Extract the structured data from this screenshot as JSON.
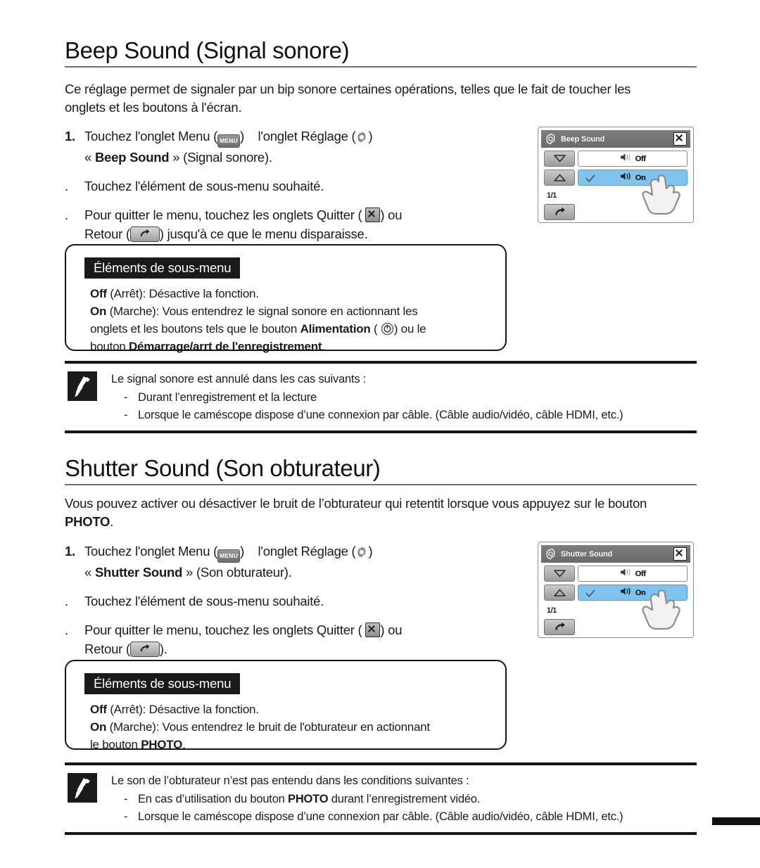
{
  "sections": [
    {
      "heading": "Beep Sound (Signal sonore)",
      "intro": "Ce réglage permet de signaler par un bip sonore certaines opérations, telles que le fait de toucher les onglets et les boutons à l'écran.",
      "steps": [
        {
          "marker": "1.",
          "line1_a": "Touchez l'onglet Menu (",
          "line1_b": ")",
          "line1_c": "l'onglet Réglage (",
          "line1_d": ")",
          "line2_a": "« ",
          "line2_b": "Beep Sound",
          "line2_c": " » (Signal sonore)."
        },
        {
          "marker": ".",
          "line1_a": "Touchez l'élément de sous-menu souhaité."
        },
        {
          "marker": ".",
          "line1_a": "Pour quitter le menu, touchez les onglets Quitter ( ",
          "line1_b": ") ou",
          "line2_a": "Retour (",
          "line2_b": ") jusqu'à ce que le menu disparaisse."
        }
      ],
      "submenu": {
        "title": "Éléments de sous-menu",
        "lines": [
          {
            "bold": "Off",
            "rest": " (Arrêt): Désactive la fonction."
          },
          {
            "bold": "On",
            "rest": " (Marche): Vous entendrez le signal sonore en actionnant les"
          },
          {
            "plain_a": "onglets et les boutons tels que le bouton ",
            "bold": "Alimentation",
            "plain_b": " ( ",
            "plain_c": ") ou le"
          },
          {
            "plain_a": "bouton ",
            "bold": "Démarrage/arrt de l'enregistrement",
            "plain_b": "."
          }
        ]
      },
      "note": {
        "lead": "Le signal sonore est annulé dans les cas suivants :",
        "bullets": [
          "Durant l’enregistrement et la lecture",
          "Lorsque le caméscope dispose d’une connexion par câble. (Câble audio/vidéo, câble HDMI, etc.)"
        ]
      },
      "lcd": {
        "title": "Beep Sound",
        "page_indicator": "1/1",
        "rows": [
          {
            "label": "Off",
            "selected": false
          },
          {
            "label": "On",
            "selected": true
          }
        ]
      }
    },
    {
      "heading": "Shutter Sound (Son obturateur)",
      "intro_a": "Vous pouvez activer ou désactiver le bruit de l’obturateur qui retentit lorsque vous appuyez sur le bouton ",
      "intro_b": "PHOTO",
      "intro_c": ".",
      "steps": [
        {
          "marker": "1.",
          "line1_a": "Touchez l'onglet Menu (",
          "line1_b": ")",
          "line1_c": "l'onglet Réglage (",
          "line1_d": ")",
          "line2_a": "« ",
          "line2_b": "Shutter Sound",
          "line2_c": " » (Son obturateur)."
        },
        {
          "marker": ".",
          "line1_a": "Touchez l'élément de sous-menu souhaité."
        },
        {
          "marker": ".",
          "line1_a": "Pour quitter le menu, touchez les onglets Quitter ( ",
          "line1_b": ") ou",
          "line2_a": "Retour (",
          "line2_b": ")."
        }
      ],
      "submenu": {
        "title": "Éléments de sous-menu",
        "lines": [
          {
            "bold": "Off",
            "rest": " (Arrêt): Désactive la fonction."
          },
          {
            "bold": "On",
            "rest": " (Marche): Vous entendrez le bruit de l'obturateur en actionnant"
          },
          {
            "plain_a": "le bouton ",
            "bold": "PHOTO",
            "plain_b": "."
          }
        ]
      },
      "note": {
        "lead": "Le son de l’obturateur n’est pas entendu dans les conditions suivantes :",
        "bullets": [
          {
            "a": "En cas d’utilisation du bouton ",
            "bold": "PHOTO",
            "b": " durant l’enregistrement vidéo."
          },
          {
            "a": "Lorsque le caméscope dispose d’une connexion par câble. (Câble audio/vidéo, câble HDMI, etc.)"
          }
        ]
      },
      "lcd": {
        "title": "Shutter Sound",
        "page_indicator": "1/1",
        "rows": [
          {
            "label": "Off",
            "selected": false
          },
          {
            "label": "On",
            "selected": true
          }
        ]
      }
    }
  ],
  "icons": {
    "menu_label": "MENU",
    "gear": "gear-icon",
    "exit": "exit-icon",
    "back": "back-icon",
    "power": "power-icon",
    "note": "note-icon",
    "hand": "hand-pointer-icon"
  },
  "colors": {
    "selected_row": "#7ec4ef",
    "header_bar": "#7e7e7e",
    "submenu_title_bg": "#1a1a1a",
    "rule": "#6f6f6f"
  },
  "bullet_dash": "-"
}
